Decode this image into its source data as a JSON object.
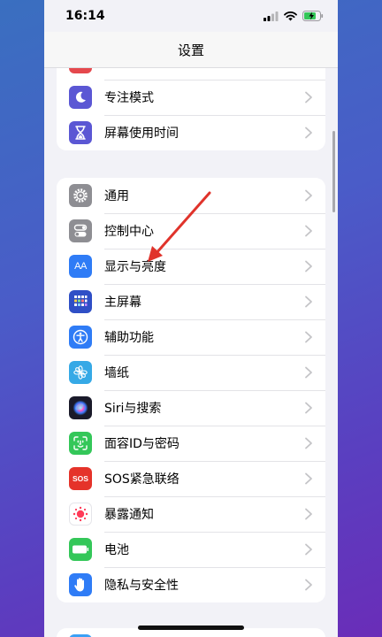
{
  "status_bar": {
    "time": "16:14"
  },
  "nav": {
    "title": "设置"
  },
  "groups": {
    "top": [
      {
        "label": "专注模式",
        "icon": "moon-icon",
        "color": "#5b57d4"
      },
      {
        "label": "屏幕使用时间",
        "icon": "hourglass-icon",
        "color": "#5b57d4"
      }
    ],
    "main": [
      {
        "label": "通用",
        "icon": "gear-icon",
        "color": "#8e8e93"
      },
      {
        "label": "控制中心",
        "icon": "toggles-icon",
        "color": "#8e8e93"
      },
      {
        "label": "显示与亮度",
        "icon": "text-size-icon",
        "color": "#2f7cf6"
      },
      {
        "label": "主屏幕",
        "icon": "app-grid-icon",
        "color": "#2f4fc6"
      },
      {
        "label": "辅助功能",
        "icon": "accessibility-icon",
        "color": "#2f7cf6"
      },
      {
        "label": "墙纸",
        "icon": "flower-icon",
        "color": "#36a9e6"
      },
      {
        "label": "Siri与搜索",
        "icon": "siri-icon",
        "color": "#1a1a2a"
      },
      {
        "label": "面容ID与密码",
        "icon": "face-id-icon",
        "color": "#34c759"
      },
      {
        "label": "SOS紧急联络",
        "icon": "sos-icon",
        "color": "#e5332a"
      },
      {
        "label": "暴露通知",
        "icon": "exposure-icon",
        "color": "#ffffff"
      },
      {
        "label": "电池",
        "icon": "battery-icon",
        "color": "#34c759"
      },
      {
        "label": "隐私与安全性",
        "icon": "hand-icon",
        "color": "#2f7cf6"
      }
    ]
  },
  "icon_text": {
    "text_size": "AA",
    "sos": "SOS"
  },
  "colors": {
    "annotation_arrow": "#e0332b"
  }
}
